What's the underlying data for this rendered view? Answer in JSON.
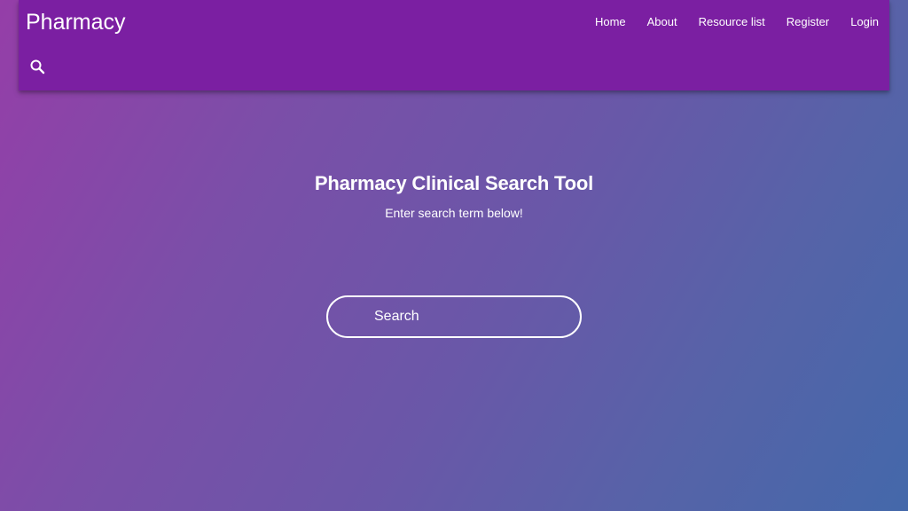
{
  "navbar": {
    "brand": "Pharmacy",
    "links": [
      {
        "label": "Home"
      },
      {
        "label": "About"
      },
      {
        "label": "Resource list"
      },
      {
        "label": "Register"
      },
      {
        "label": "Login"
      }
    ],
    "search_icon": "search-icon"
  },
  "hero": {
    "title": "Pharmacy Clinical Search Tool",
    "subtitle": "Enter search term below!"
  },
  "search": {
    "placeholder": "Search",
    "value": ""
  },
  "colors": {
    "navbar_bg": "#7b1fa2",
    "gradient_start": "#953ea8",
    "gradient_end": "#4468aa",
    "text": "#ffffff"
  }
}
